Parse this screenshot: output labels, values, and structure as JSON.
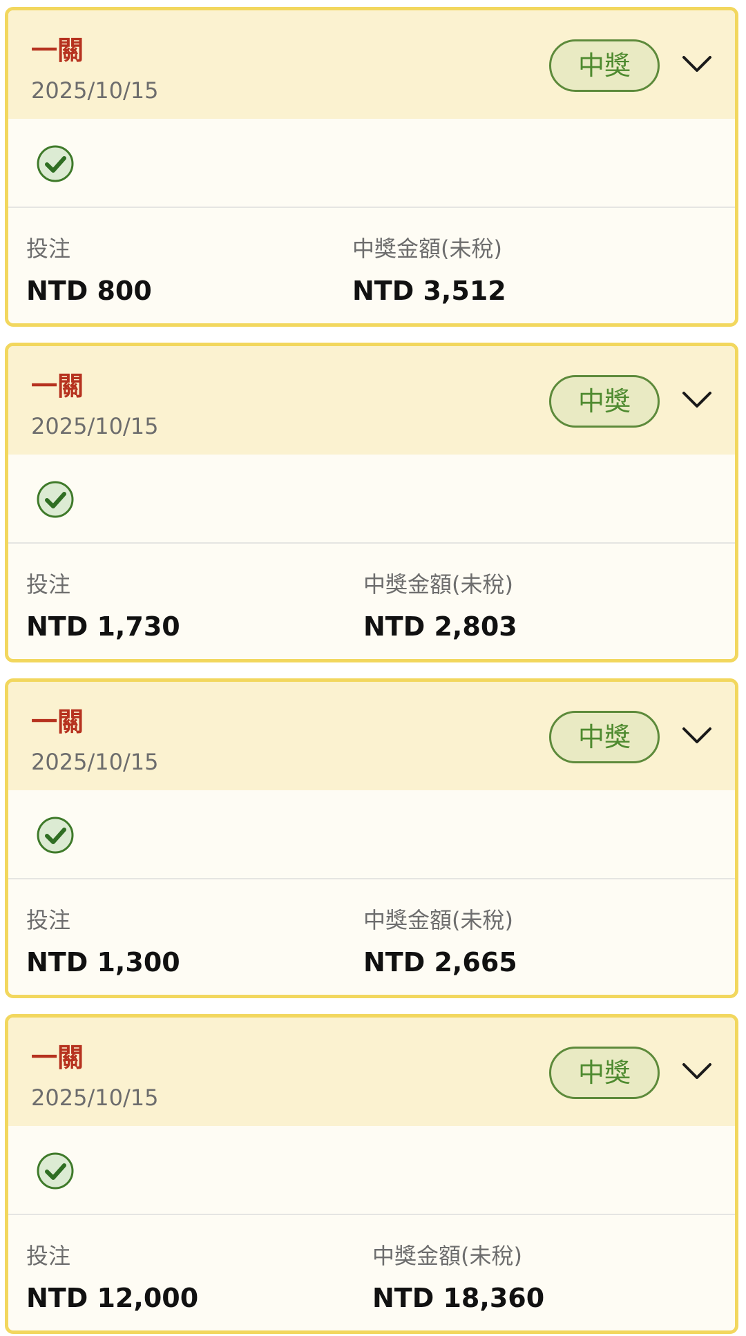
{
  "tickets": [
    {
      "title": "一關",
      "date": "2025/10/15",
      "badge": "中獎",
      "bet_label": "投注",
      "bet_amount": "NTD 800",
      "prize_label": "中獎金額(未稅)",
      "prize_amount": "NTD 3,512"
    },
    {
      "title": "一關",
      "date": "2025/10/15",
      "badge": "中獎",
      "bet_label": "投注",
      "bet_amount": "NTD 1,730",
      "prize_label": "中獎金額(未稅)",
      "prize_amount": "NTD 2,803"
    },
    {
      "title": "一關",
      "date": "2025/10/15",
      "badge": "中獎",
      "bet_label": "投注",
      "bet_amount": "NTD 1,300",
      "prize_label": "中獎金額(未稅)",
      "prize_amount": "NTD 2,665"
    },
    {
      "title": "一關",
      "date": "2025/10/15",
      "badge": "中獎",
      "bet_label": "投注",
      "bet_amount": "NTD 12,000",
      "prize_label": "中獎金額(未稅)",
      "prize_amount": "NTD 18,360"
    }
  ],
  "icons": {
    "status": "check-circle-icon",
    "expand": "chevron-down-icon"
  },
  "colors": {
    "card_border": "#f2d75e",
    "header_background": "#fbf2d0",
    "body_background": "#fefcf4",
    "title_red": "#b6321f",
    "win_green": "#4e8a2f",
    "badge_background": "#e9eac3"
  }
}
